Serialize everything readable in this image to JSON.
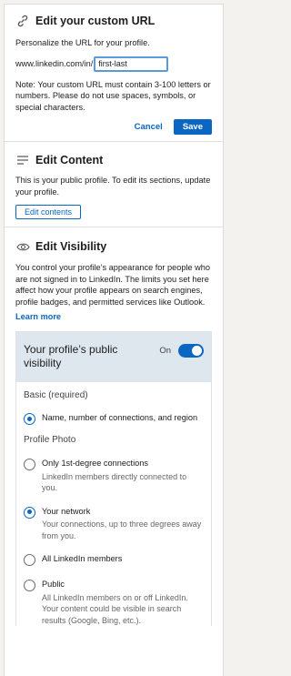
{
  "url_section": {
    "title": "Edit your custom URL",
    "icon": "link-icon",
    "description": "Personalize the URL for your profile.",
    "url_prefix": "www.linkedin.com/in/",
    "url_value": "first-last",
    "note": "Note: Your custom URL must contain 3-100 letters or numbers. Please do not use spaces, symbols, or special characters.",
    "cancel_label": "Cancel",
    "save_label": "Save"
  },
  "content_section": {
    "title": "Edit Content",
    "icon": "lines-icon",
    "description": "This is your public profile. To edit its sections, update your profile.",
    "button_label": "Edit contents"
  },
  "visibility_section": {
    "title": "Edit Visibility",
    "icon": "eye-icon",
    "description": "You control your profile’s appearance for people who are not signed in to LinkedIn. The limits you set here affect how your profile appears on search engines, profile badges, and permitted services like Outlook.",
    "learn_more": "Learn more",
    "card": {
      "title": "Your profile’s public visibility",
      "toggle_label": "On",
      "toggle_on": true,
      "basic_label": "Basic (required)",
      "basic_option": "Name, number of connections, and region",
      "photo_label": "Profile Photo",
      "options": [
        {
          "label": "Only 1st-degree connections",
          "description": "LinkedIn members directly connected to you.",
          "checked": false
        },
        {
          "label": "Your network",
          "description": "Your connections, up to three degrees away from you.",
          "checked": true
        },
        {
          "label": "All LinkedIn members",
          "description": "",
          "checked": false
        },
        {
          "label": "Public",
          "description": "All LinkedIn members on or off LinkedIn. Your content could be visible in search results (Google, Bing, etc.).",
          "checked": false
        }
      ]
    }
  },
  "colors": {
    "accent": "#0a66c2",
    "card_header": "#dfe7ee"
  }
}
